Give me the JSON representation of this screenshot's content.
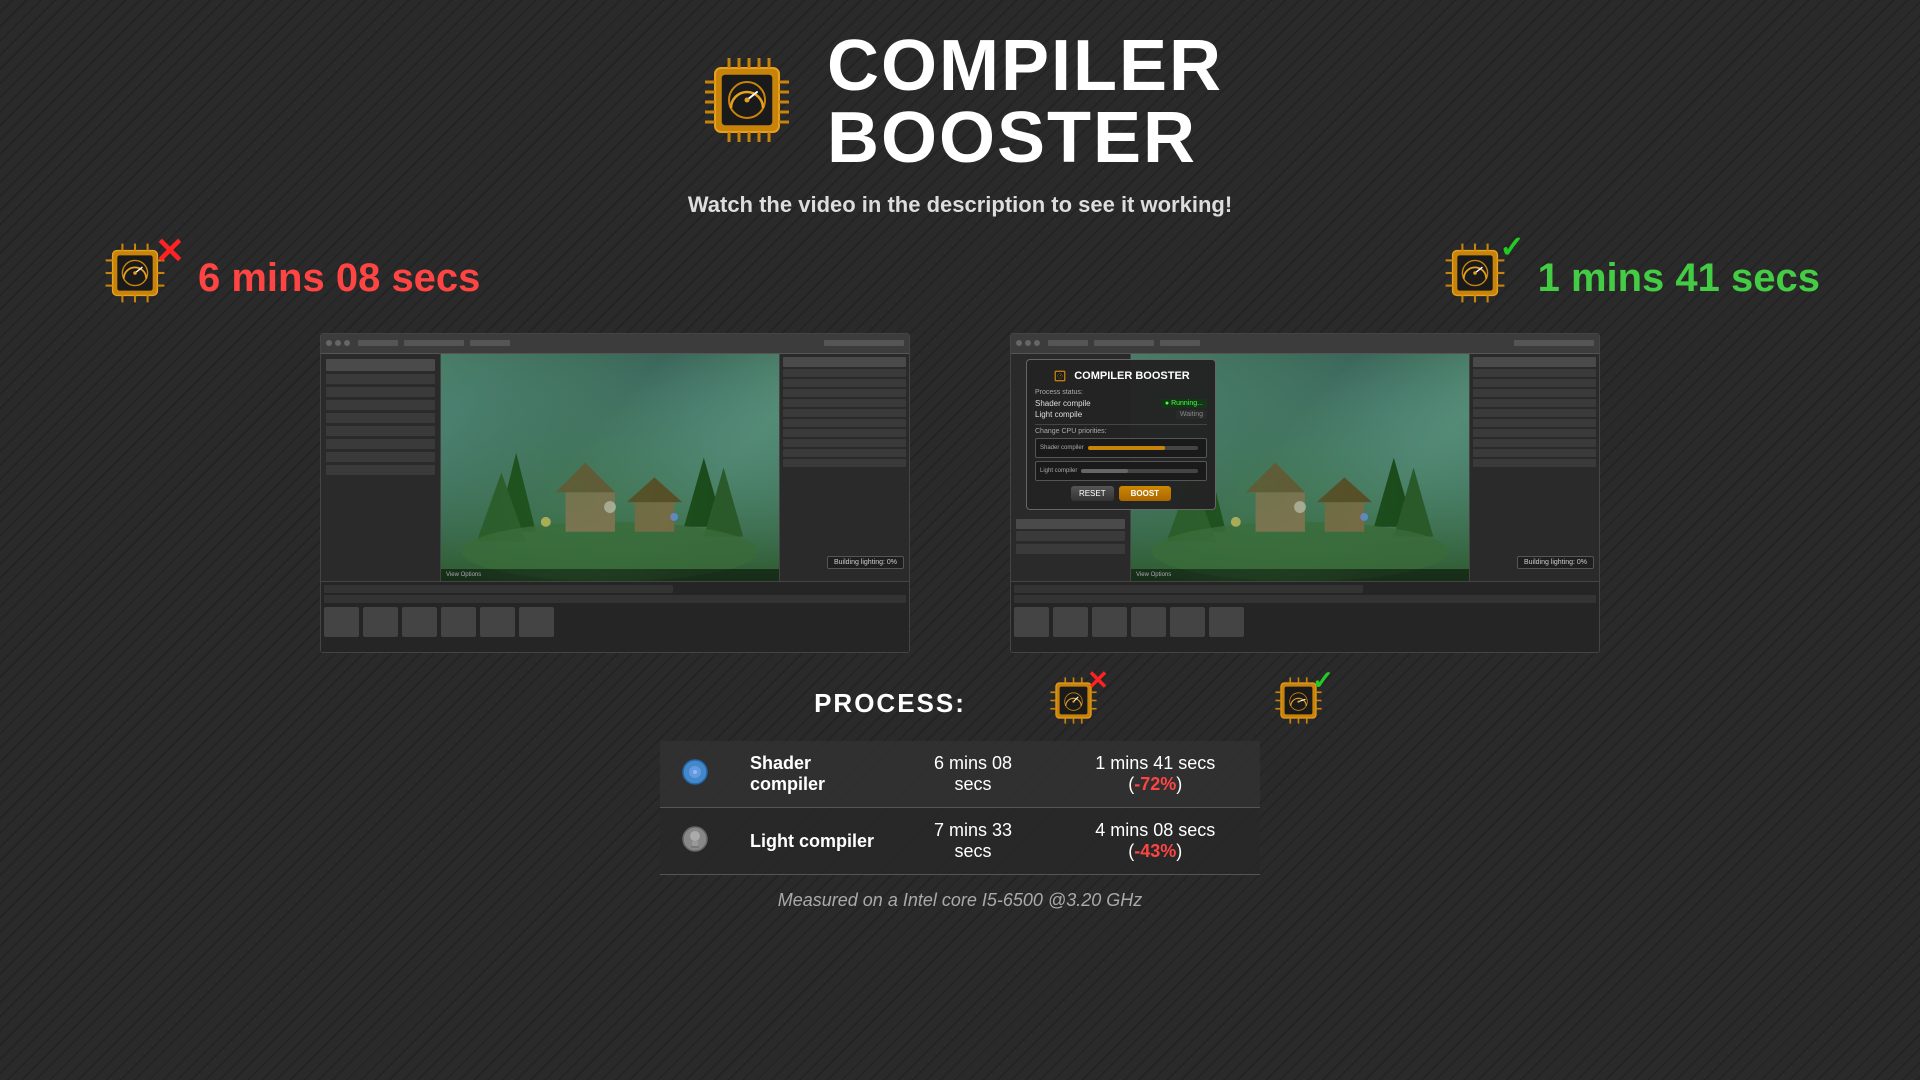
{
  "header": {
    "title_line1": "COMPILER",
    "title_line2": "BOOSTER",
    "subtitle": "Watch the video in the description to see it working!"
  },
  "timing": {
    "before_label": "6 mins 08 secs",
    "after_label": "1 mins 41 secs"
  },
  "table": {
    "process_label": "PROCESS:",
    "rows": [
      {
        "icon": "🔵",
        "label": "Shader compiler",
        "time_before": "6 mins 08 secs",
        "time_after": "1 mins 41 secs (-72%)",
        "percent": "-72%"
      },
      {
        "icon": "⚪",
        "label": "Light compiler",
        "time_before": "7 mins 33 secs",
        "time_after": "4 mins 08 secs (-43%)",
        "percent": "-43%"
      }
    ],
    "measured": "Measured on a Intel core I5-6500 @3.20 GHz"
  },
  "booster_ui": {
    "title": "COMPILER BOOSTER",
    "process_status": "Process status:",
    "shader_label": "Shader compile",
    "light_label": "Light compile",
    "cpu_priorities": "Change CPU priorities:",
    "reset_label": "RESET",
    "boost_label": "BOOST"
  }
}
